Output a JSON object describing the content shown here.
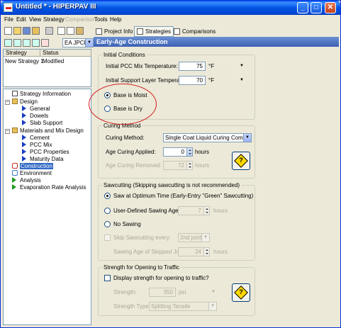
{
  "window": {
    "title": "Untitled * - HIPERPAV III"
  },
  "title_buttons": {
    "minimize": "_",
    "maximize": "□",
    "close": "✕"
  },
  "menu": [
    "File",
    "Edit",
    "View",
    "Strategy",
    "Comparison",
    "Tools",
    "Help"
  ],
  "toolbar": {
    "tabs": [
      "Project Info",
      "Strategies",
      "Comparisons"
    ],
    "pavement_type": "EA JPCP"
  },
  "strategy_list": {
    "headers": [
      "Strategy",
      "Status"
    ],
    "rows": [
      {
        "name": "New Strategy 1",
        "status": "Modified"
      }
    ]
  },
  "tree": {
    "items": [
      "Strategy Information",
      "Design",
      "General",
      "Dowels",
      "Slab Support",
      "Materials and Mix Design",
      "Cement",
      "PCC Mix",
      "PCC Properties",
      "Maturity Data",
      "Construction",
      "Environment",
      "Analysis",
      "Evaporation Rate Analysis"
    ],
    "expand_symbol": "−"
  },
  "panel": {
    "title": "Early-Age Construction"
  },
  "initial_conditions": {
    "title": "Initial Conditions",
    "pcc_temp_label": "Initial PCC Mix Temperature:",
    "pcc_temp_value": "75",
    "support_temp_label": "Initial Support Layer Temperature:",
    "support_temp_value": "70",
    "unit": "°F",
    "base_moist_label": "Base is Moist",
    "base_dry_label": "Base is Dry"
  },
  "curing": {
    "title": "Curing Method",
    "method_label": "Curing Method:",
    "method_value": "Single Coat Liquid Curing Compound",
    "age_applied_label": "Age Curing Applied:",
    "age_applied_value": "0",
    "age_removed_label": "Age Curing Removed:",
    "age_removed_value": "72",
    "unit": "hours"
  },
  "sawcutting": {
    "title": "Sawcutting (Skipping sawcutting is not recommended)",
    "opt_optimum": "Saw at Optimum Time (Early-Entry \"Green\" Sawcutting)",
    "opt_user": "User-Defined Sawing Age",
    "user_age_value": "7",
    "opt_no": "No Sawing",
    "skip_label": "Skip Sawcutting every:",
    "skip_value": "2nd joint",
    "skipped_age_label": "Sawing Age of Skipped Joints:",
    "skipped_age_value": "24",
    "unit": "hours"
  },
  "strength": {
    "title": "Strength for Opening to Traffic",
    "display_label": "Display strength for opening to traffic?",
    "strength_label": "Strength:",
    "strength_value": "350",
    "strength_unit": "psi",
    "type_label": "Strength Type:",
    "type_value": "Splitting Tensile"
  },
  "help_symbol": "?",
  "dropdown_arrow": "▼",
  "colors": {
    "annotation": "#d02020",
    "header": "#3b61b4",
    "selection": "#316ac5"
  }
}
